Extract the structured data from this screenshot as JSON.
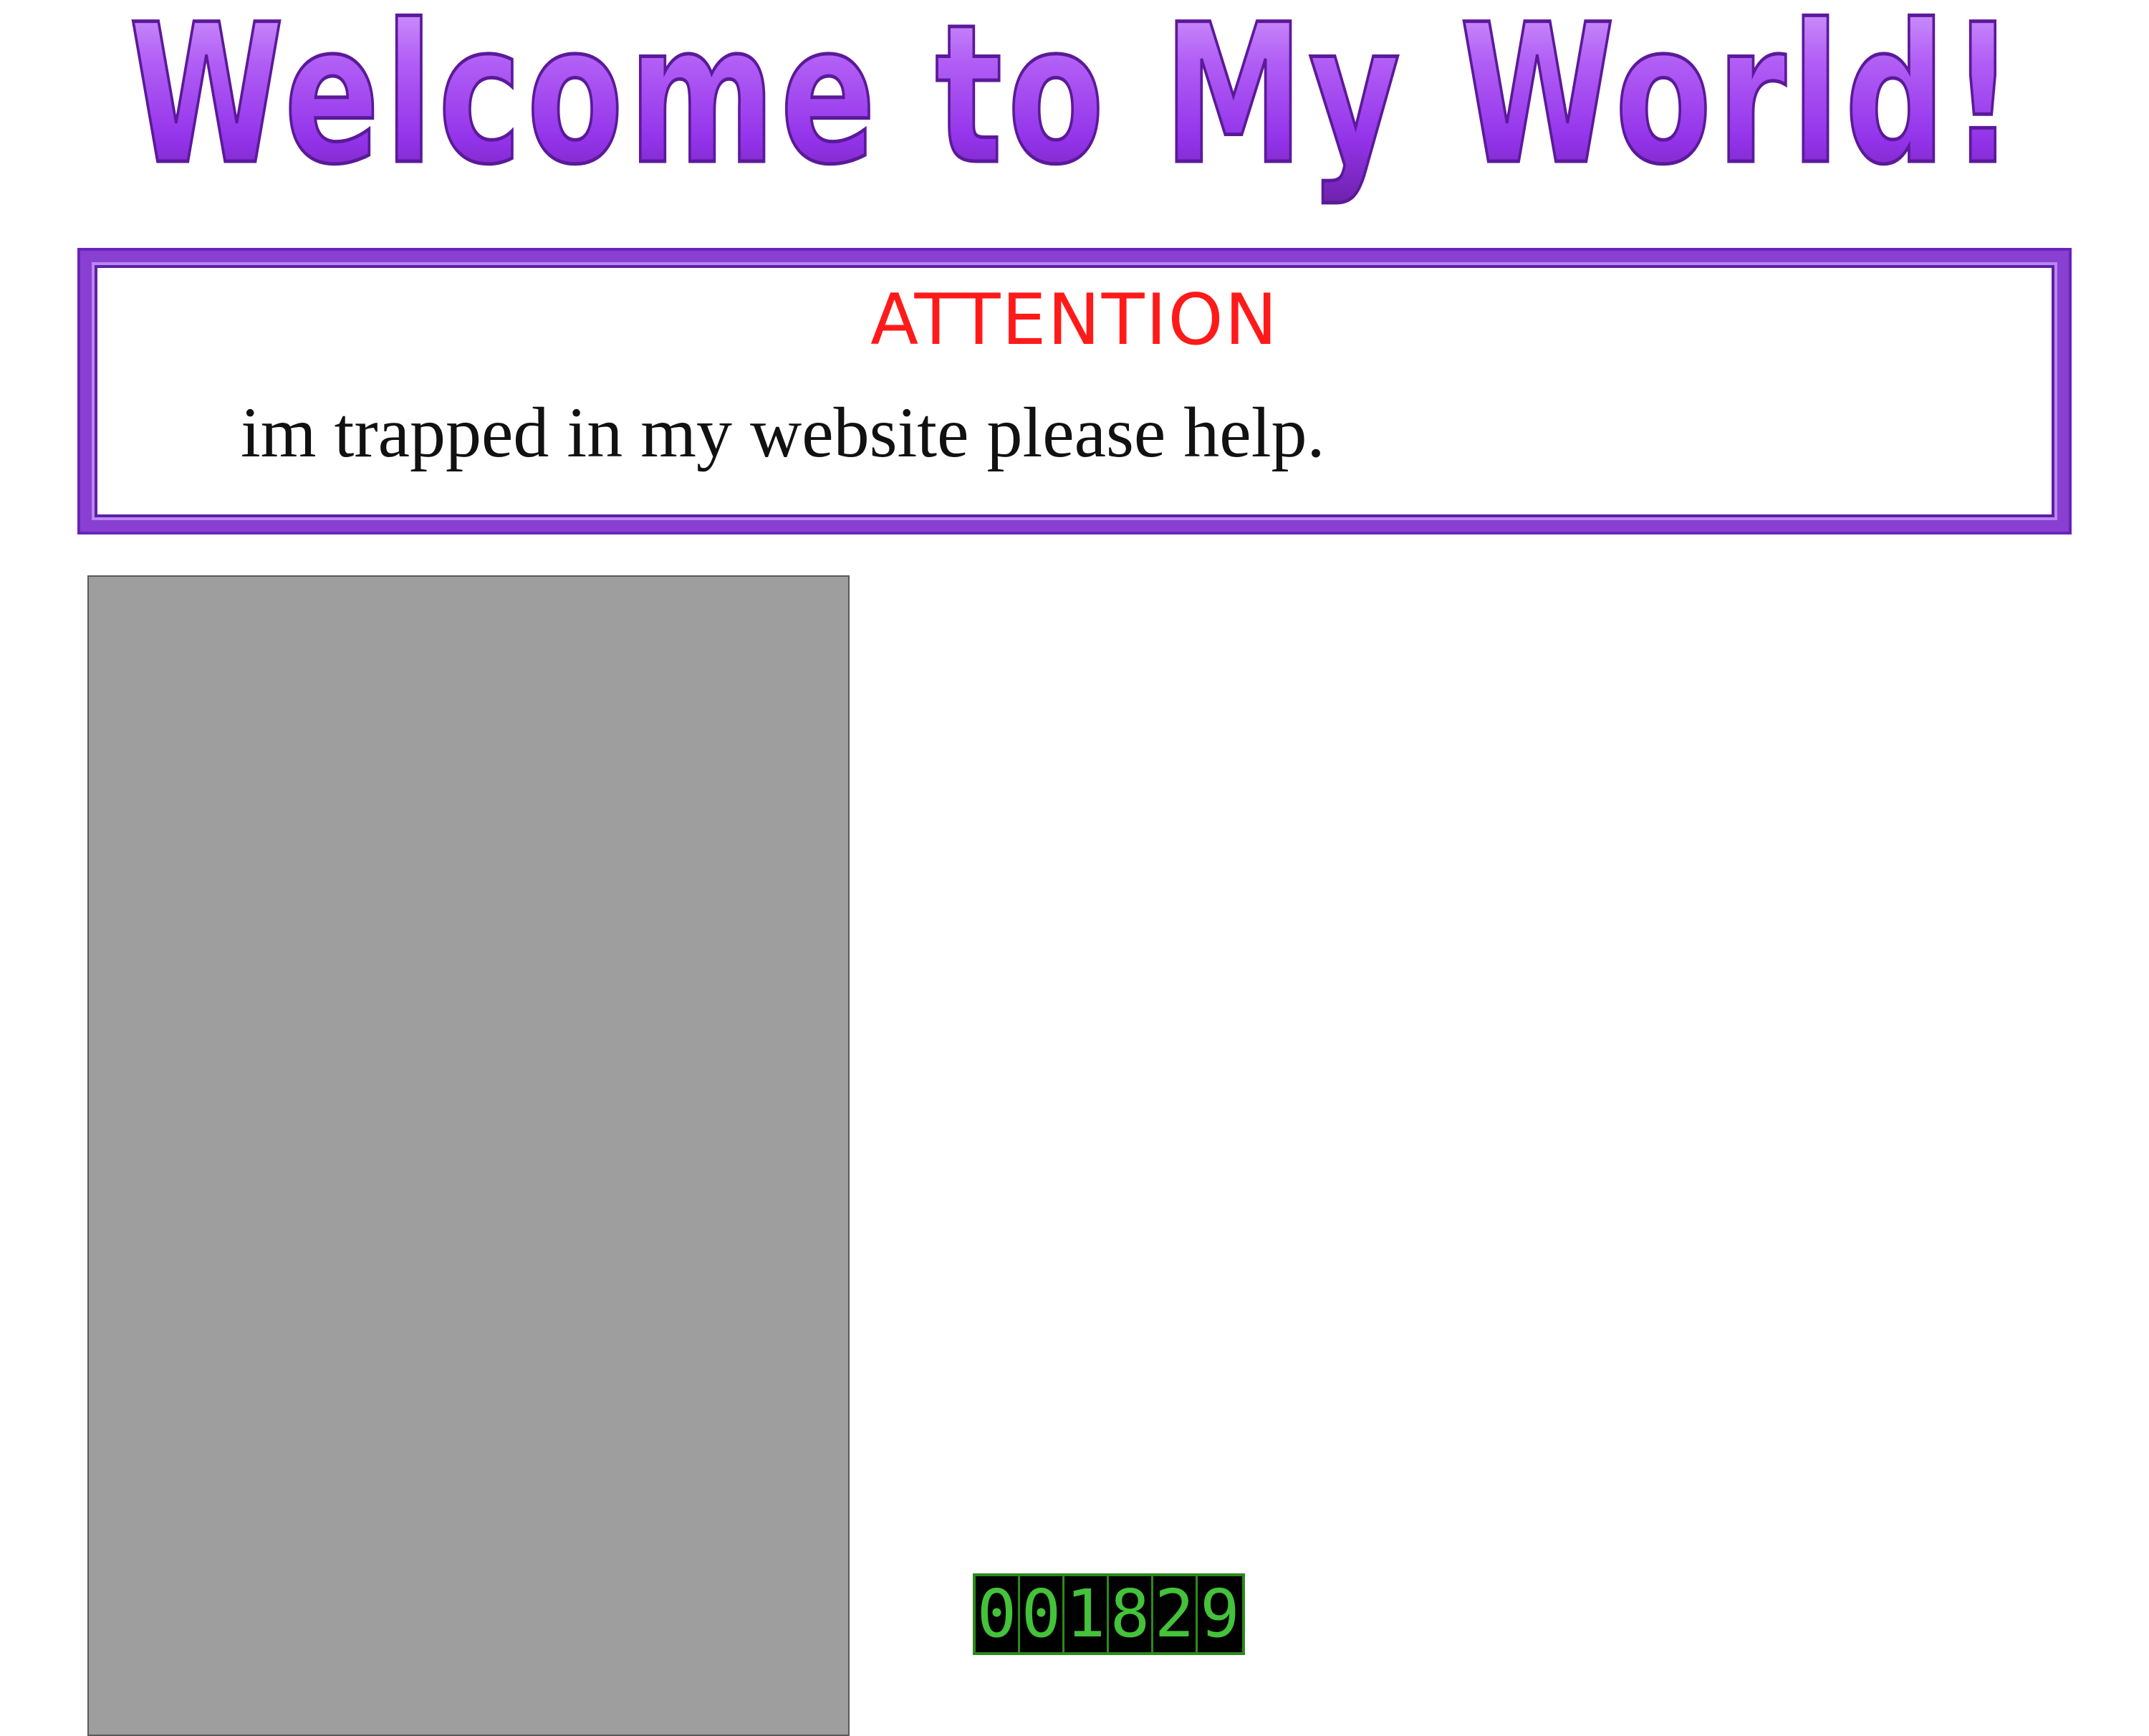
{
  "header": {
    "title": "Welcome to My World!"
  },
  "notice": {
    "heading": "ATTENTION",
    "message": "im trapped in my website please help."
  },
  "hit_counter": {
    "value": "001829",
    "digits": [
      "0",
      "0",
      "1",
      "8",
      "2",
      "9"
    ]
  },
  "colors": {
    "title_purple": "#a855f7",
    "border_purple": "#8a3fd3",
    "attention_red": "#ff1a1a",
    "panel_gray": "#9e9e9e",
    "counter_green": "#44c23a",
    "counter_bg": "#000000"
  }
}
